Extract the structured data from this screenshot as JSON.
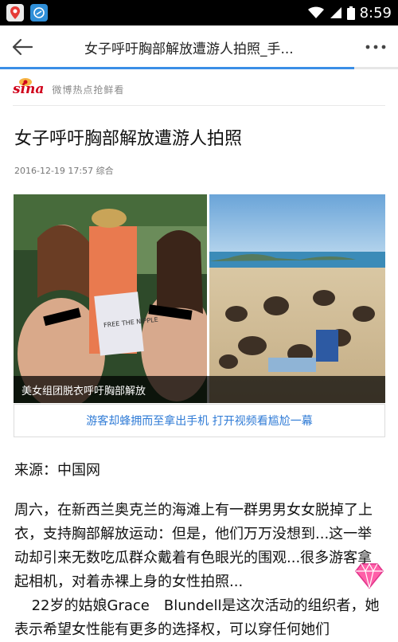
{
  "status_bar": {
    "time": "8:59"
  },
  "toolbar": {
    "title": "女子呼吁胸部解放遭游人拍照_手..."
  },
  "page_load_progress": 0.89,
  "source": {
    "logo_text": "sina",
    "slogan": "微博热点抢鲜看"
  },
  "article": {
    "headline": "女子呼吁胸部解放遭游人拍照",
    "meta": "2016-12-19 17:57 综合",
    "image_caption": "美女组团脱衣呼吁胸部解放",
    "video_link": "游客却蜂拥而至拿出手机 打开视频看尴尬一幕",
    "source_line": "来源：中国网",
    "paragraphs": [
      "周六，在新西兰奥克兰的海滩上有一群男男女女脱掉了上衣，支持胸部解放运动：但是，他们万万没想到...这一举动却引来无数吃瓜群众戴着有色眼光的围观...很多游客拿起相机，对着赤裸上身的女性拍照...",
      "22岁的姑娘Grace　Blundell是这次活动的组织者，她表示希望女性能有更多的选择权，可以穿任何她们"
    ],
    "sign_text": "FREE THE NIPPLE"
  }
}
